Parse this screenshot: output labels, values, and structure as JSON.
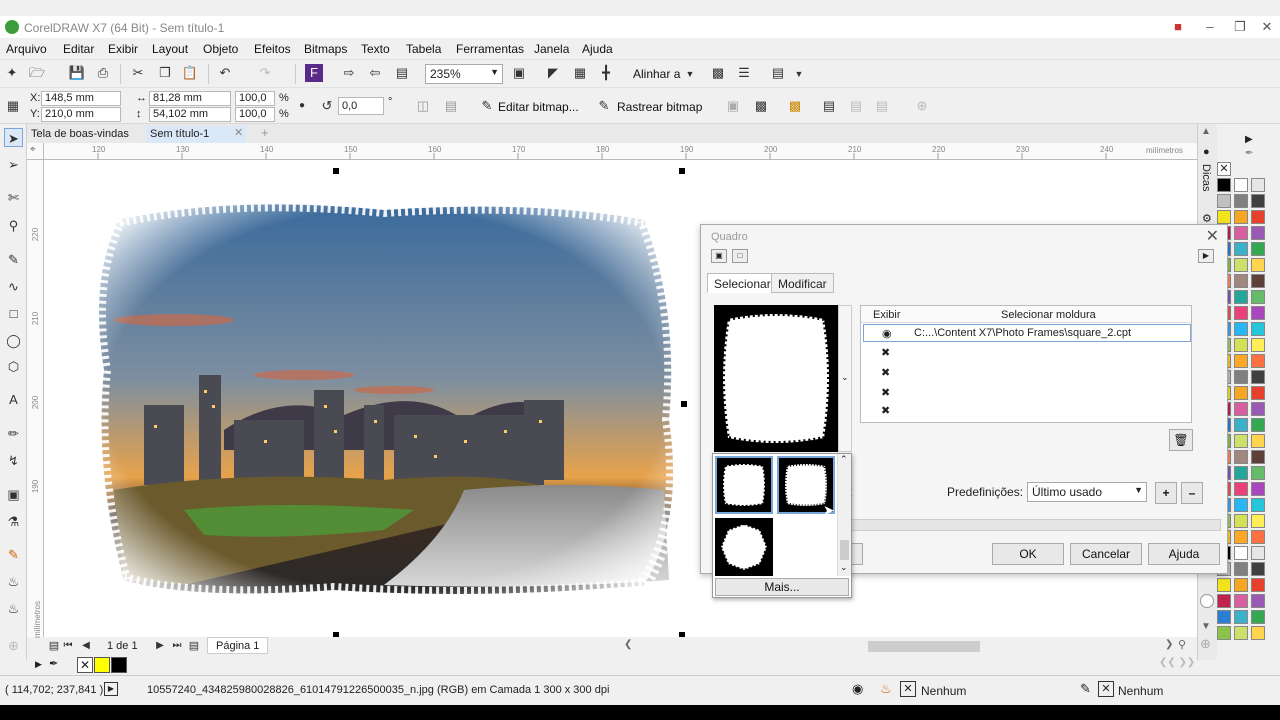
{
  "window": {
    "title": "CorelDRAW X7 (64 Bit) - Sem título-1"
  },
  "menu": [
    "Arquivo",
    "Editar",
    "Exibir",
    "Layout",
    "Objeto",
    "Efeitos",
    "Bitmaps",
    "Texto",
    "Tabela",
    "Ferramentas",
    "Janela",
    "Ajuda"
  ],
  "toolbar": {
    "zoom": "235%",
    "align_label": "Alinhar a"
  },
  "propertybar": {
    "x": "148,5 mm",
    "y": "210,0 mm",
    "width": "81,28 mm",
    "height": "54,102 mm",
    "scale_x": "100,0",
    "scale_y": "100,0",
    "pct": "%",
    "angle": "0,0",
    "deg": "°",
    "edit_bitmap": "Editar bitmap...",
    "trace_bitmap": "Rastrear bitmap"
  },
  "tabs": [
    "Tela de boas-vindas",
    "Sem título-1"
  ],
  "ruler": {
    "h_labels": [
      "120",
      "130",
      "140",
      "150",
      "160",
      "170",
      "180",
      "190",
      "200",
      "210",
      "220",
      "230",
      "240"
    ],
    "unit": "milímetros",
    "v_labels": [
      "220",
      "210",
      "200",
      "190"
    ]
  },
  "dock": {
    "hints_label": "Dicas"
  },
  "dialog": {
    "title": "Quadro",
    "tabs": [
      "Selecionar",
      "Modificar"
    ],
    "col_show": "Exibir",
    "col_frame": "Selecionar moldura",
    "frame_path": "C:...\\Content X7\\Photo Frames\\square_2.cpt",
    "partial_text": "t",
    "presets_label": "Predefinições:",
    "presets_value": "Último usado",
    "ok": "OK",
    "cancel": "Cancelar",
    "help": "Ajuda",
    "more": "Mais..."
  },
  "pagenav": {
    "counter": "1 de 1",
    "page_tab": "Página 1"
  },
  "status": {
    "coords": "( 114,702; 237,841 )",
    "info": "10557240_434825980028826_61014791226500035_n.jpg (RGB) em Camada 1 300 x 300 dpi",
    "fill": "Nenhum",
    "outline": "Nenhum"
  },
  "colors": {
    "accent": "#2f6fb5",
    "palette": [
      "#000000",
      "#ffffff",
      "#e6e6e6",
      "#c0c0c0",
      "#808080",
      "#404040",
      "#f2e41b",
      "#f5a623",
      "#e8402a",
      "#c0244d",
      "#d95fa1",
      "#9b59b6",
      "#2a7fd4",
      "#3bb0c9",
      "#35a853",
      "#8bc34a",
      "#cde06b",
      "#ffd54f",
      "#ff8a65",
      "#a1887f",
      "#5d4037",
      "#7e57c2",
      "#26a69a",
      "#66bb6a",
      "#ef5350",
      "#ec407a",
      "#ab47bc",
      "#42a5f5",
      "#29b6f6",
      "#26c6da",
      "#9ccc65",
      "#d4e157",
      "#ffee58",
      "#ffca28",
      "#ffa726",
      "#ff7043"
    ]
  }
}
